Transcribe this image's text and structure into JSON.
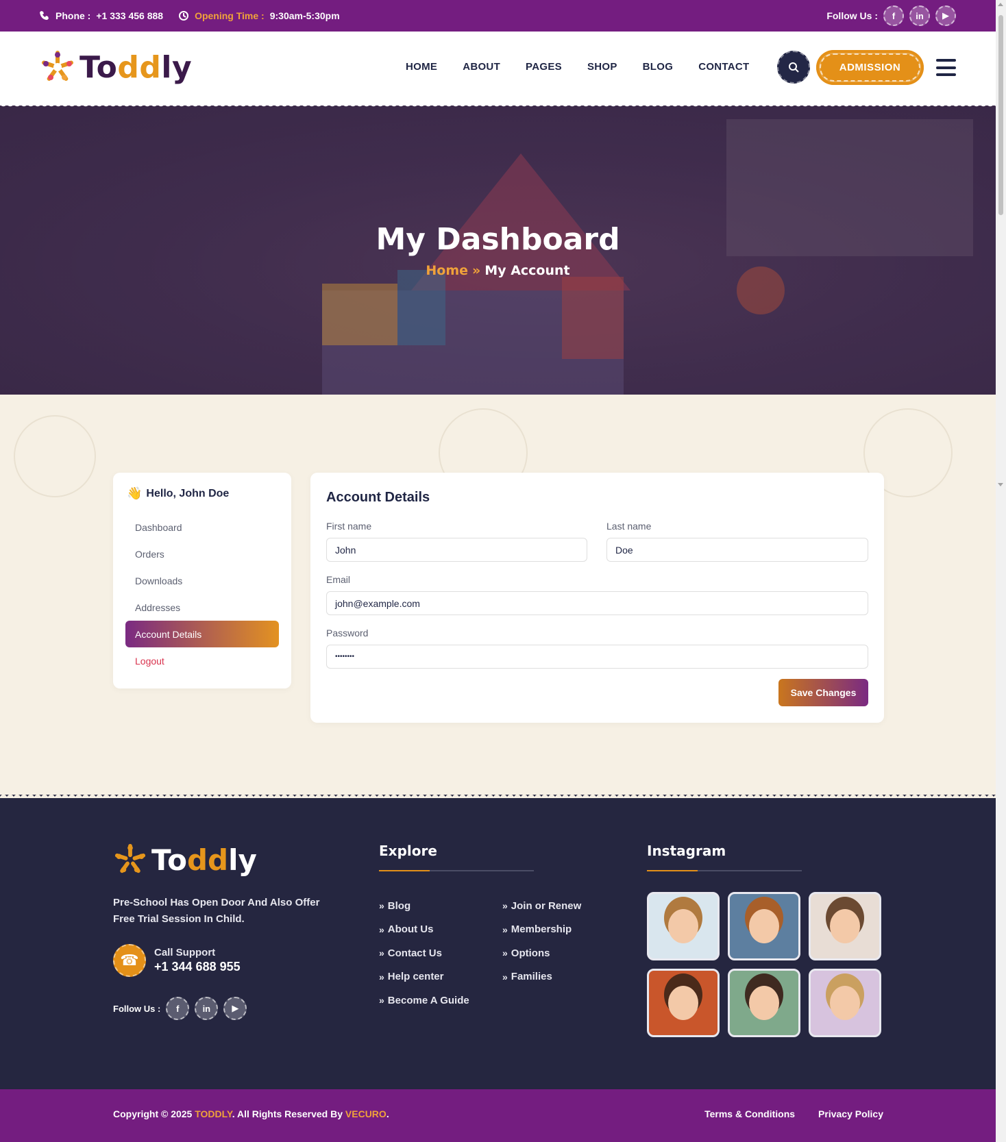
{
  "topbar": {
    "phone_label": "Phone :",
    "phone_value": "+1 333 456 888",
    "hours_label": "Opening Time :",
    "hours_value": "9:30am-5:30pm",
    "follow_label": "Follow Us :",
    "social": [
      "facebook-icon",
      "linkedin-icon",
      "youtube-icon"
    ]
  },
  "header": {
    "logo_to": "To",
    "logo_dd": "dd",
    "logo_ly": "ly",
    "nav": [
      "HOME",
      "ABOUT",
      "PAGES",
      "SHOP",
      "BLOG",
      "CONTACT"
    ],
    "admission_label": "ADMISSION"
  },
  "hero": {
    "title": "My Dashboard",
    "crumb_home": "Home",
    "crumb_sep": "»",
    "crumb_current": "My Account"
  },
  "sidebar": {
    "greeting": "Hello, John Doe",
    "items": [
      "Dashboard",
      "Orders",
      "Downloads",
      "Addresses",
      "Account Details",
      "Logout"
    ],
    "active": "Account Details"
  },
  "account": {
    "heading": "Account Details",
    "first_name_label": "First name",
    "first_name_value": "John",
    "last_name_label": "Last name",
    "last_name_value": "Doe",
    "email_label": "Email",
    "email_value": "john@example.com",
    "password_label": "Password",
    "password_value": "••••••••",
    "save_label": "Save Changes"
  },
  "footer": {
    "logo_to": "To",
    "logo_dd": "dd",
    "logo_ly": "ly",
    "tagline": "Pre-School Has Open Door And Also Offer Free Trial Session In Child.",
    "call_label": "Call Support",
    "call_number": "+1 344 688 955",
    "follow_label": "Follow Us :",
    "explore_heading": "Explore",
    "explore_col1": [
      "Blog",
      "About Us",
      "Contact Us",
      "Help center",
      "Become A Guide"
    ],
    "explore_col2": [
      "Join or Renew",
      "Membership",
      "Options",
      "Families"
    ],
    "instagram_heading": "Instagram",
    "copyright_pre": "Copyright © 2025 ",
    "copyright_brand": "TODDLY",
    "copyright_mid": ". All Rights Reserved By ",
    "copyright_author": "VECURO",
    "copyright_end": ".",
    "terms": "Terms & Conditions",
    "privacy": "Privacy Policy"
  },
  "colors": {
    "brand_purple": "#741d80",
    "brand_orange": "#e49018",
    "dark_navy": "#252640",
    "cream": "#f6f0e4"
  }
}
